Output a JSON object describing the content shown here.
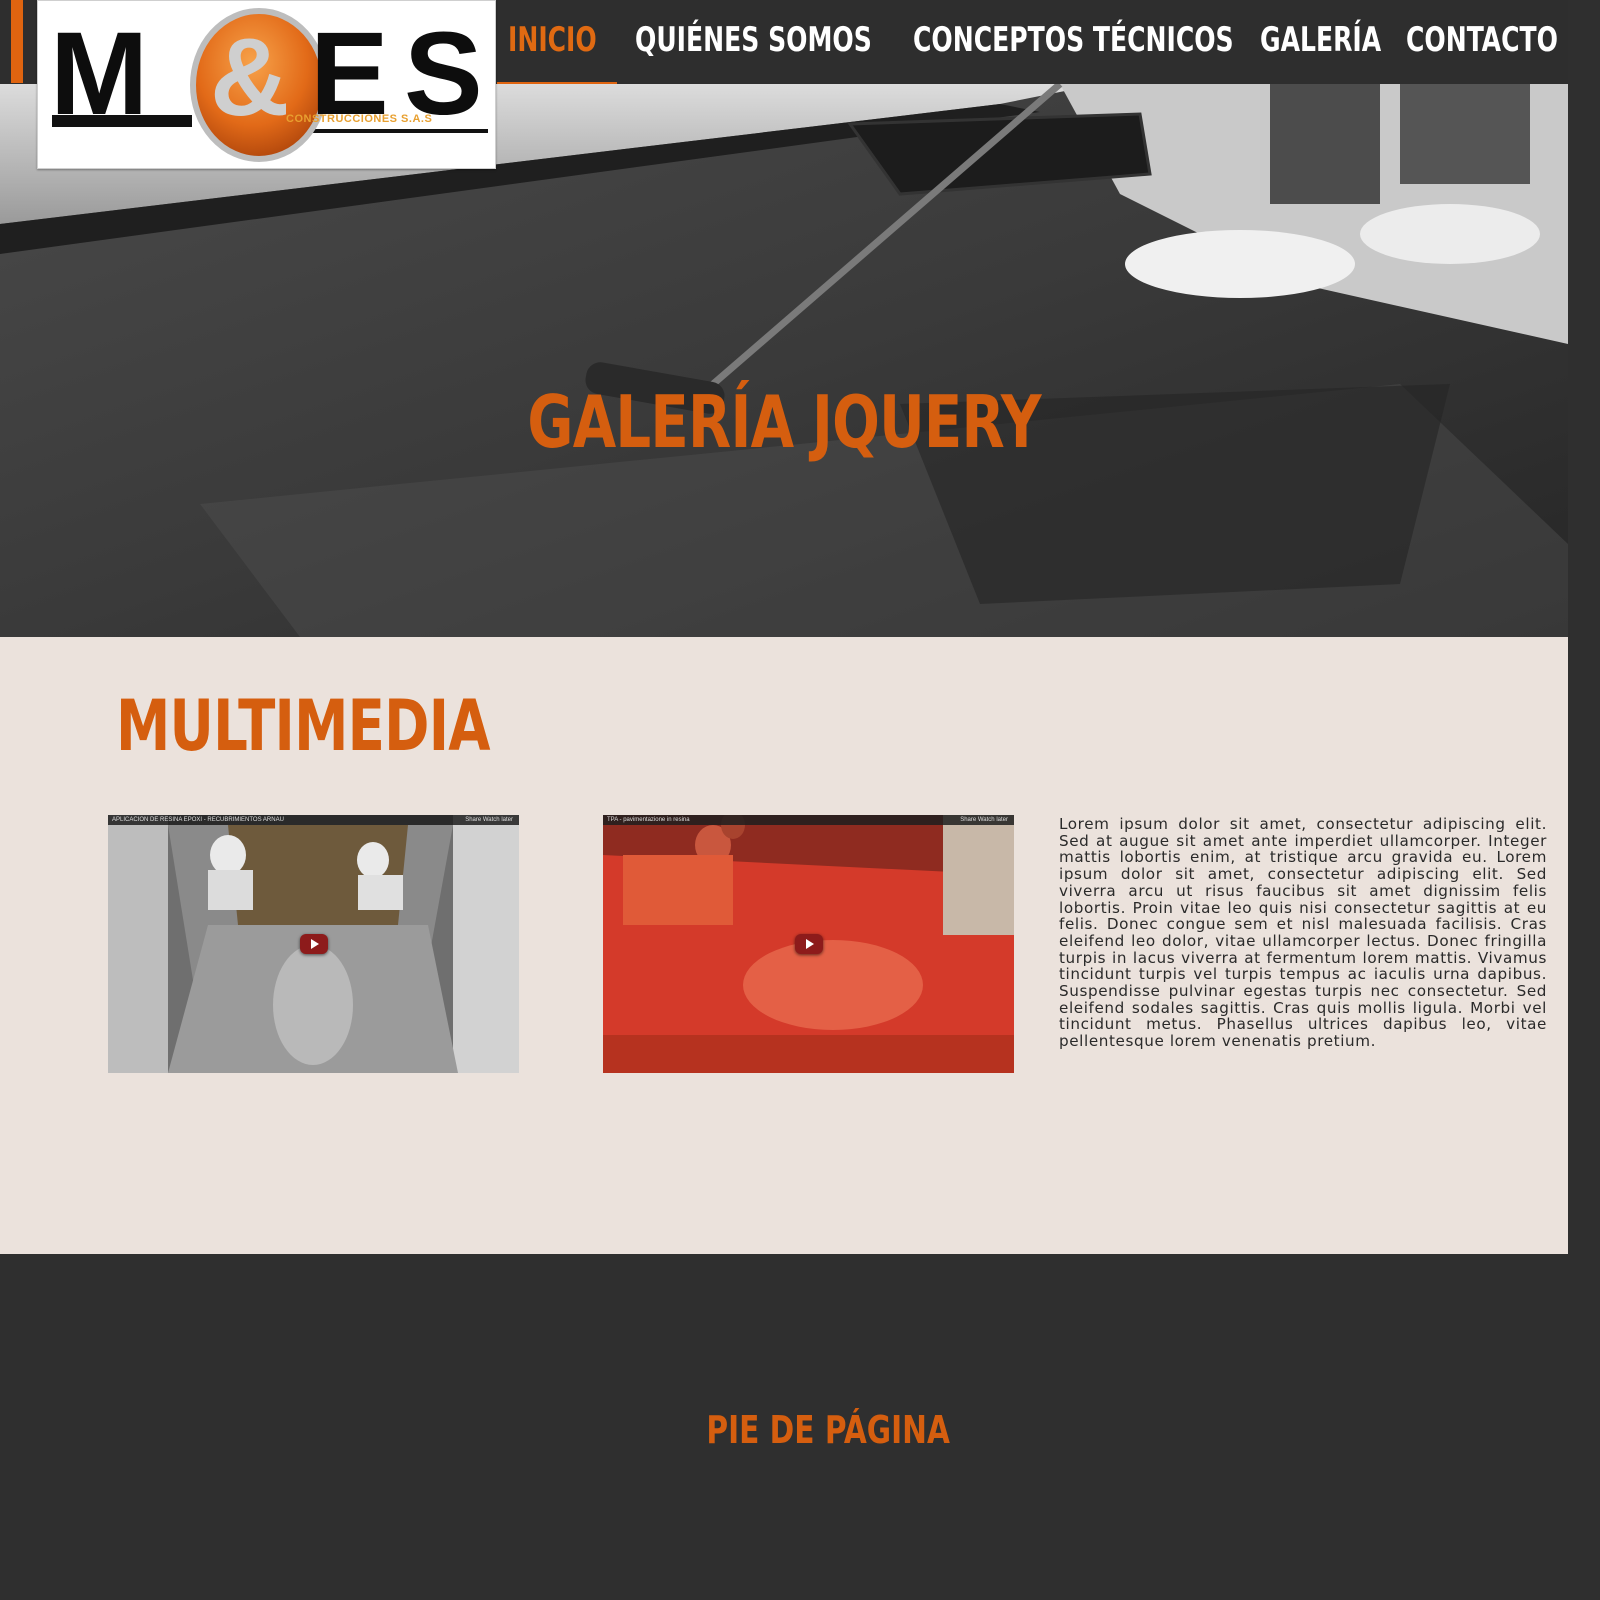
{
  "brand": {
    "logo_letters": [
      "M",
      "&",
      "E",
      "S"
    ],
    "logo_subtitle": "CONSTRUCCIONES S.A.S",
    "accent_color": "#df6410"
  },
  "nav": {
    "items": [
      {
        "label": "INICIO",
        "active": true
      },
      {
        "label": "QUIÉNES SOMOS",
        "active": false
      },
      {
        "label": "CONCEPTOS TÉCNICOS",
        "active": false
      },
      {
        "label": "GALERÍA",
        "active": false
      },
      {
        "label": "CONTACTO",
        "active": false
      }
    ]
  },
  "hero": {
    "title": "GALERÍA JQUERY"
  },
  "multimedia": {
    "title": "MULTIMEDIA",
    "videos": [
      {
        "caption": "APLICACION DE RESINA EPOXI - RECUBRIMIENTOS ARNAU",
        "controls": "Share   Watch later",
        "icon": "play-icon"
      },
      {
        "caption": "TPA - pavimentazione in resina",
        "controls": "Share   Watch later",
        "icon": "play-icon"
      }
    ],
    "text": "Lorem ipsum dolor sit amet, consectetur adipiscing elit. Sed at augue sit amet ante imperdiet ullamcorper. Integer mattis lobortis enim, at tristique arcu gravida eu. Lorem ipsum dolor sit amet, consectetur adipiscing elit. Sed viverra arcu ut risus faucibus sit amet dignissim felis lobortis. Proin vitae leo quis nisi consectetur sagittis at eu felis. Donec congue sem et nisl malesuada facilisis. Cras eleifend leo dolor, vitae ullamcorper lectus. Donec fringilla turpis in lacus viverra at fermentum lorem mattis. Vivamus tincidunt turpis vel turpis tempus ac iaculis urna dapibus. Suspendisse pulvinar egestas turpis nec consectetur. Sed eleifend sodales sagittis. Cras quis mollis ligula. Morbi vel tincidunt metus. Phasellus ultrices dapibus leo, vitae pellentesque lorem venenatis pretium."
  },
  "footer": {
    "text": "PIE DE PÁGINA"
  }
}
